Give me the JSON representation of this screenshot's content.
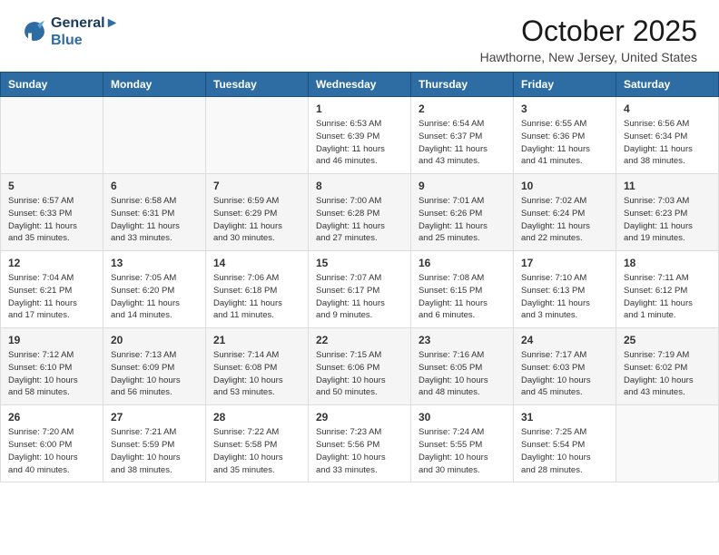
{
  "header": {
    "logo_line1": "General",
    "logo_line2": "Blue",
    "month_title": "October 2025",
    "location": "Hawthorne, New Jersey, United States"
  },
  "days_of_week": [
    "Sunday",
    "Monday",
    "Tuesday",
    "Wednesday",
    "Thursday",
    "Friday",
    "Saturday"
  ],
  "weeks": [
    {
      "days": [
        {
          "num": "",
          "info": ""
        },
        {
          "num": "",
          "info": ""
        },
        {
          "num": "",
          "info": ""
        },
        {
          "num": "1",
          "info": "Sunrise: 6:53 AM\nSunset: 6:39 PM\nDaylight: 11 hours\nand 46 minutes."
        },
        {
          "num": "2",
          "info": "Sunrise: 6:54 AM\nSunset: 6:37 PM\nDaylight: 11 hours\nand 43 minutes."
        },
        {
          "num": "3",
          "info": "Sunrise: 6:55 AM\nSunset: 6:36 PM\nDaylight: 11 hours\nand 41 minutes."
        },
        {
          "num": "4",
          "info": "Sunrise: 6:56 AM\nSunset: 6:34 PM\nDaylight: 11 hours\nand 38 minutes."
        }
      ]
    },
    {
      "days": [
        {
          "num": "5",
          "info": "Sunrise: 6:57 AM\nSunset: 6:33 PM\nDaylight: 11 hours\nand 35 minutes."
        },
        {
          "num": "6",
          "info": "Sunrise: 6:58 AM\nSunset: 6:31 PM\nDaylight: 11 hours\nand 33 minutes."
        },
        {
          "num": "7",
          "info": "Sunrise: 6:59 AM\nSunset: 6:29 PM\nDaylight: 11 hours\nand 30 minutes."
        },
        {
          "num": "8",
          "info": "Sunrise: 7:00 AM\nSunset: 6:28 PM\nDaylight: 11 hours\nand 27 minutes."
        },
        {
          "num": "9",
          "info": "Sunrise: 7:01 AM\nSunset: 6:26 PM\nDaylight: 11 hours\nand 25 minutes."
        },
        {
          "num": "10",
          "info": "Sunrise: 7:02 AM\nSunset: 6:24 PM\nDaylight: 11 hours\nand 22 minutes."
        },
        {
          "num": "11",
          "info": "Sunrise: 7:03 AM\nSunset: 6:23 PM\nDaylight: 11 hours\nand 19 minutes."
        }
      ]
    },
    {
      "days": [
        {
          "num": "12",
          "info": "Sunrise: 7:04 AM\nSunset: 6:21 PM\nDaylight: 11 hours\nand 17 minutes."
        },
        {
          "num": "13",
          "info": "Sunrise: 7:05 AM\nSunset: 6:20 PM\nDaylight: 11 hours\nand 14 minutes."
        },
        {
          "num": "14",
          "info": "Sunrise: 7:06 AM\nSunset: 6:18 PM\nDaylight: 11 hours\nand 11 minutes."
        },
        {
          "num": "15",
          "info": "Sunrise: 7:07 AM\nSunset: 6:17 PM\nDaylight: 11 hours\nand 9 minutes."
        },
        {
          "num": "16",
          "info": "Sunrise: 7:08 AM\nSunset: 6:15 PM\nDaylight: 11 hours\nand 6 minutes."
        },
        {
          "num": "17",
          "info": "Sunrise: 7:10 AM\nSunset: 6:13 PM\nDaylight: 11 hours\nand 3 minutes."
        },
        {
          "num": "18",
          "info": "Sunrise: 7:11 AM\nSunset: 6:12 PM\nDaylight: 11 hours\nand 1 minute."
        }
      ]
    },
    {
      "days": [
        {
          "num": "19",
          "info": "Sunrise: 7:12 AM\nSunset: 6:10 PM\nDaylight: 10 hours\nand 58 minutes."
        },
        {
          "num": "20",
          "info": "Sunrise: 7:13 AM\nSunset: 6:09 PM\nDaylight: 10 hours\nand 56 minutes."
        },
        {
          "num": "21",
          "info": "Sunrise: 7:14 AM\nSunset: 6:08 PM\nDaylight: 10 hours\nand 53 minutes."
        },
        {
          "num": "22",
          "info": "Sunrise: 7:15 AM\nSunset: 6:06 PM\nDaylight: 10 hours\nand 50 minutes."
        },
        {
          "num": "23",
          "info": "Sunrise: 7:16 AM\nSunset: 6:05 PM\nDaylight: 10 hours\nand 48 minutes."
        },
        {
          "num": "24",
          "info": "Sunrise: 7:17 AM\nSunset: 6:03 PM\nDaylight: 10 hours\nand 45 minutes."
        },
        {
          "num": "25",
          "info": "Sunrise: 7:19 AM\nSunset: 6:02 PM\nDaylight: 10 hours\nand 43 minutes."
        }
      ]
    },
    {
      "days": [
        {
          "num": "26",
          "info": "Sunrise: 7:20 AM\nSunset: 6:00 PM\nDaylight: 10 hours\nand 40 minutes."
        },
        {
          "num": "27",
          "info": "Sunrise: 7:21 AM\nSunset: 5:59 PM\nDaylight: 10 hours\nand 38 minutes."
        },
        {
          "num": "28",
          "info": "Sunrise: 7:22 AM\nSunset: 5:58 PM\nDaylight: 10 hours\nand 35 minutes."
        },
        {
          "num": "29",
          "info": "Sunrise: 7:23 AM\nSunset: 5:56 PM\nDaylight: 10 hours\nand 33 minutes."
        },
        {
          "num": "30",
          "info": "Sunrise: 7:24 AM\nSunset: 5:55 PM\nDaylight: 10 hours\nand 30 minutes."
        },
        {
          "num": "31",
          "info": "Sunrise: 7:25 AM\nSunset: 5:54 PM\nDaylight: 10 hours\nand 28 minutes."
        },
        {
          "num": "",
          "info": ""
        }
      ]
    }
  ]
}
